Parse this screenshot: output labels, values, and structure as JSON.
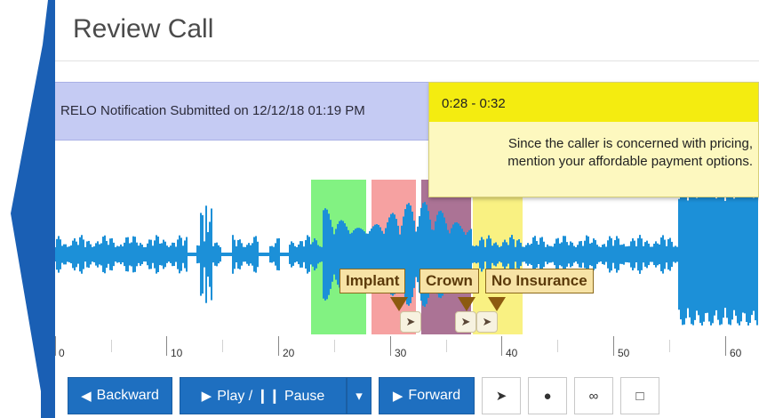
{
  "page_title": "Review Call",
  "notification": {
    "text": "RELO Notification Submitted on 12/12/18 01:19 PM"
  },
  "tip_popup": {
    "time_range": "0:28 - 0:32",
    "message_line1": "Since the caller is concerned with pricing,",
    "message_line2": "mention your affordable payment options."
  },
  "waveform": {
    "highlights": [
      {
        "label": "",
        "color": "#6cf06c"
      },
      {
        "label": "",
        "color": "#f59090"
      },
      {
        "label": "",
        "color": "#9c5a82"
      },
      {
        "label": "",
        "color": "#f8ef6c"
      }
    ]
  },
  "tags": [
    {
      "label": "Implant"
    },
    {
      "label": "Crown"
    },
    {
      "label": "No Insurance"
    }
  ],
  "timeline": {
    "labels": [
      "0",
      "10",
      "20",
      "30",
      "40",
      "50",
      "60"
    ]
  },
  "controls": {
    "backward_label": "Backward",
    "play_pause_label": "Play / ❙❙ Pause",
    "forward_label": "Forward"
  },
  "colors": {
    "primary_button": "#1e6fc0",
    "side_bar": "#1a5fb4",
    "notification_bg": "#c5cbf3",
    "popup_header": "#f4ec10"
  }
}
